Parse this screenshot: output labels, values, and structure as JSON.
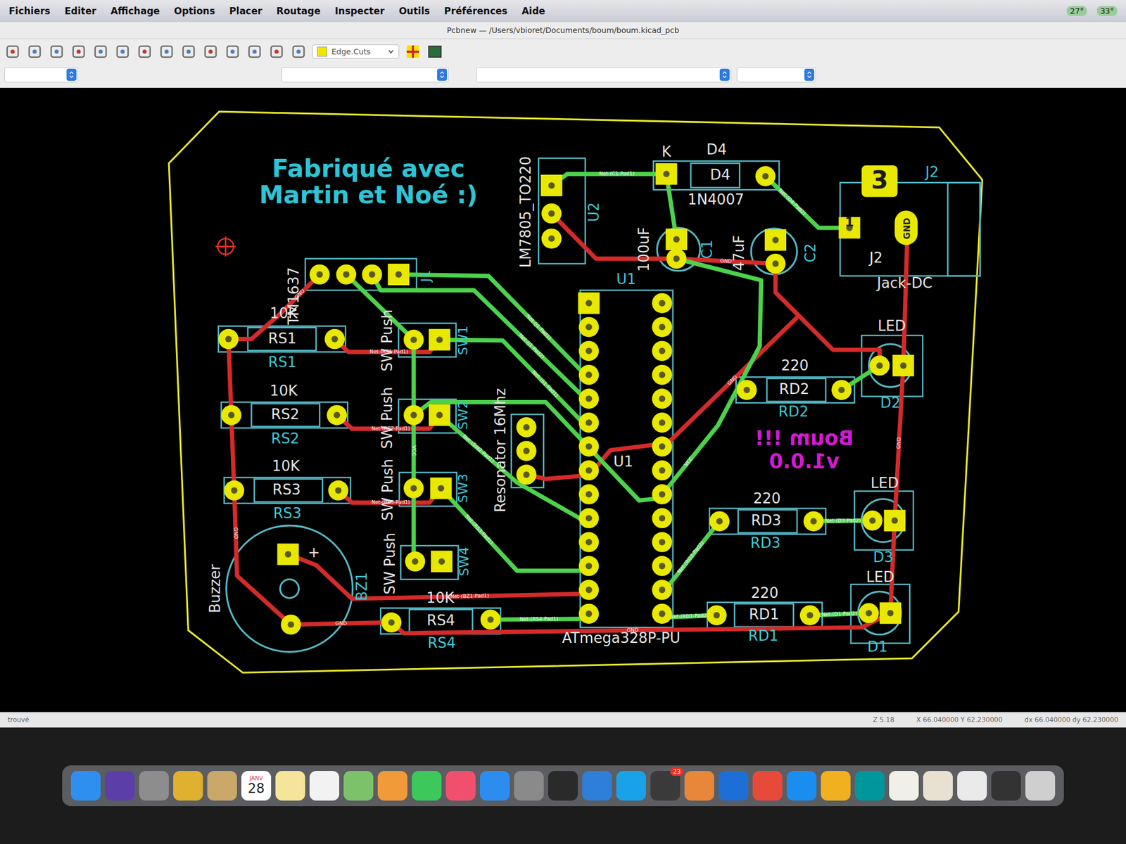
{
  "menubar": {
    "items": [
      "Fichiers",
      "Editer",
      "Affichage",
      "Options",
      "Placer",
      "Routage",
      "Inspecter",
      "Outils",
      "Préférences",
      "Aide"
    ],
    "status": [
      "27°",
      "33°"
    ]
  },
  "window": {
    "title": "Pcbnew — /Users/vbioret/Documents/boum/boum.kicad_pcb"
  },
  "toolbar": {
    "layer": "Edge.Cuts"
  },
  "board": {
    "texts": [
      {
        "text": "Fabriqué avec",
        "kind": "top"
      },
      {
        "text": "Martin et Noé :)",
        "kind": "top"
      },
      {
        "text": "Boum !!!",
        "kind": "mirrored"
      },
      {
        "text": "v1.0.0",
        "kind": "mirrored"
      }
    ],
    "components": [
      {
        "labels": [
          {
            "text": "TM1637",
            "kind": "value"
          },
          {
            "text": "J1",
            "kind": "reference"
          }
        ]
      },
      {
        "labels": [
          {
            "text": "10K",
            "kind": "value"
          },
          {
            "text": "RS1",
            "kind": "value"
          },
          {
            "text": "RS1",
            "kind": "reference"
          }
        ]
      },
      {
        "labels": [
          {
            "text": "10K",
            "kind": "value"
          },
          {
            "text": "RS2",
            "kind": "value"
          },
          {
            "text": "RS2",
            "kind": "reference"
          }
        ]
      },
      {
        "labels": [
          {
            "text": "10K",
            "kind": "value"
          },
          {
            "text": "RS3",
            "kind": "value"
          },
          {
            "text": "RS3",
            "kind": "reference"
          }
        ]
      },
      {
        "labels": [
          {
            "text": "10K",
            "kind": "value"
          },
          {
            "text": "RS4",
            "kind": "value"
          },
          {
            "text": "RS4",
            "kind": "reference"
          }
        ]
      },
      {
        "labels": [
          {
            "text": "SW Push",
            "kind": "value"
          },
          {
            "text": "SW1",
            "kind": "reference"
          }
        ]
      },
      {
        "labels": [
          {
            "text": "SW Push",
            "kind": "value"
          },
          {
            "text": "SW2",
            "kind": "reference"
          }
        ]
      },
      {
        "labels": [
          {
            "text": "SW Push",
            "kind": "value"
          },
          {
            "text": "SW3",
            "kind": "reference"
          }
        ]
      },
      {
        "labels": [
          {
            "text": "SW Push",
            "kind": "value"
          },
          {
            "text": "SW4",
            "kind": "reference"
          }
        ]
      },
      {
        "labels": [
          {
            "text": "Resonator 16Mhz",
            "kind": "value"
          }
        ]
      },
      {
        "labels": [
          {
            "text": "U1",
            "kind": "reference"
          },
          {
            "text": "U1",
            "kind": "value"
          },
          {
            "text": "ATmega328P-PU",
            "kind": "value"
          }
        ]
      },
      {
        "labels": [
          {
            "text": "LM7805_TO220",
            "kind": "value"
          },
          {
            "text": "U2",
            "kind": "reference"
          }
        ]
      },
      {
        "labels": [
          {
            "text": "K",
            "kind": "value"
          },
          {
            "text": "D4",
            "kind": "value"
          },
          {
            "text": "D4",
            "kind": "value"
          },
          {
            "text": "1N4007",
            "kind": "value"
          }
        ]
      },
      {
        "labels": [
          {
            "text": "100uF",
            "kind": "value"
          },
          {
            "text": "C1",
            "kind": "reference"
          }
        ]
      },
      {
        "labels": [
          {
            "text": "47uF",
            "kind": "value"
          },
          {
            "text": "C2",
            "kind": "reference"
          }
        ]
      },
      {
        "labels": [
          {
            "text": "J2",
            "kind": "reference"
          },
          {
            "text": "J2",
            "kind": "value"
          },
          {
            "text": "Jack-DC",
            "kind": "value"
          },
          {
            "text": "3",
            "kind": "pad"
          },
          {
            "text": "1",
            "kind": "pad"
          },
          {
            "text": "GND",
            "kind": "pad"
          }
        ]
      },
      {
        "labels": [
          {
            "text": "LED",
            "kind": "value"
          },
          {
            "text": "D2",
            "kind": "reference"
          }
        ]
      },
      {
        "labels": [
          {
            "text": "LED",
            "kind": "value"
          },
          {
            "text": "D3",
            "kind": "reference"
          }
        ]
      },
      {
        "labels": [
          {
            "text": "LED",
            "kind": "value"
          },
          {
            "text": "D1",
            "kind": "reference"
          }
        ]
      },
      {
        "labels": [
          {
            "text": "220",
            "kind": "value"
          },
          {
            "text": "RD2",
            "kind": "value"
          },
          {
            "text": "RD2",
            "kind": "reference"
          }
        ]
      },
      {
        "labels": [
          {
            "text": "220",
            "kind": "value"
          },
          {
            "text": "RD3",
            "kind": "value"
          },
          {
            "text": "RD3",
            "kind": "reference"
          }
        ]
      },
      {
        "labels": [
          {
            "text": "220",
            "kind": "value"
          },
          {
            "text": "RD1",
            "kind": "value"
          },
          {
            "text": "RD1",
            "kind": "reference"
          }
        ]
      },
      {
        "labels": [
          {
            "text": "+",
            "kind": "value"
          },
          {
            "text": "Buzzer",
            "kind": "value"
          },
          {
            "text": "BZ1",
            "kind": "reference"
          }
        ]
      }
    ],
    "tracks": [
      {
        "layer": "back",
        "net": "GND"
      },
      {
        "layer": "back",
        "net": "GND"
      },
      {
        "layer": "back",
        "net": "GND"
      },
      {
        "layer": "back",
        "net": "GND"
      },
      {
        "layer": "back",
        "net": "GND"
      },
      {
        "layer": "back",
        "net": "Net-(RS1-Pad1)"
      },
      {
        "layer": "back",
        "net": "Net-(RS2-Pad1)"
      },
      {
        "layer": "back",
        "net": "Net-(RS3-Pad1)"
      },
      {
        "layer": "back",
        "net": "Net-(BZ1-Pad1)"
      },
      {
        "layer": "back",
        "net": "GND"
      },
      {
        "layer": "back"
      },
      {
        "layer": "back",
        "net": "GND"
      },
      {
        "layer": "back"
      },
      {
        "layer": "front",
        "net": "Net-(C1-Pad1)"
      },
      {
        "layer": "front"
      },
      {
        "layer": "front",
        "net": "Net-(D4-Pad2)"
      },
      {
        "layer": "front",
        "net": "VCC"
      },
      {
        "layer": "front",
        "net": "Net-(J1-Pad1)"
      },
      {
        "layer": "front",
        "net": "Net-(J1-Pad2)"
      },
      {
        "layer": "front",
        "net": "VCC"
      },
      {
        "layer": "front",
        "net": "Net-(S1-Pad1)"
      },
      {
        "layer": "front",
        "net": "VCC"
      },
      {
        "layer": "front",
        "net": "Net-(SW2-Pad1)"
      },
      {
        "layer": "front",
        "net": "Net-(RS3-Pad1)"
      },
      {
        "layer": "front",
        "net": "Net-(RS4-Pad1)"
      },
      {
        "layer": "front",
        "net": "Net-(RD3-Pad2)"
      },
      {
        "layer": "front",
        "net": "Net-(RD1-Pad2)"
      },
      {
        "layer": "front",
        "net": "Net-(D1-Pad2)"
      },
      {
        "layer": "front",
        "net": "Net-(D3-Pad2)"
      },
      {
        "layer": "front"
      }
    ]
  },
  "status_bar": {
    "message": "trouvé",
    "zoom": "Z 5.18",
    "position": "X 66.040000  Y 62.230000",
    "delta": "dx 66.040000  dy 62.230000"
  },
  "dock": [
    {
      "kind": "app",
      "color": "#2f8ff0"
    },
    {
      "kind": "app",
      "color": "#5b3ea8"
    },
    {
      "kind": "app",
      "color": "#8d8d8d"
    },
    {
      "kind": "app",
      "color": "#e0b030"
    },
    {
      "kind": "app",
      "color": "#c9a86a"
    },
    {
      "kind": "calendar",
      "month": "JANV",
      "day": "28"
    },
    {
      "kind": "app",
      "color": "#f4e59a"
    },
    {
      "kind": "app",
      "color": "#f2f2f2"
    },
    {
      "kind": "app",
      "color": "#7cc26a"
    },
    {
      "kind": "app",
      "color": "#f09a3a"
    },
    {
      "kind": "app",
      "color": "#3cc85a"
    },
    {
      "kind": "app",
      "color": "#f0506e"
    },
    {
      "kind": "app",
      "color": "#2d8cf0"
    },
    {
      "kind": "app",
      "color": "#8a8a8a"
    },
    {
      "kind": "app",
      "color": "#2a2a2a"
    },
    {
      "kind": "app",
      "color": "#2d7fd8"
    },
    {
      "kind": "app",
      "color": "#1aa2e8"
    },
    {
      "kind": "app",
      "color": "#3a3a3a",
      "badge": "23"
    },
    {
      "kind": "app",
      "color": "#e8863a"
    },
    {
      "kind": "app",
      "color": "#1e6ed8"
    },
    {
      "kind": "app",
      "color": "#e84a3a"
    },
    {
      "kind": "app",
      "color": "#1a8ef0"
    },
    {
      "kind": "app",
      "color": "#f0b020"
    },
    {
      "kind": "app",
      "color": "#00979c"
    },
    {
      "kind": "app",
      "color": "#f0efe8"
    },
    {
      "kind": "app",
      "color": "#e8e0d0"
    },
    {
      "kind": "app",
      "color": "#eaeaea"
    },
    {
      "kind": "app",
      "color": "#333333"
    },
    {
      "kind": "app",
      "color": "#cfcfcf"
    }
  ]
}
